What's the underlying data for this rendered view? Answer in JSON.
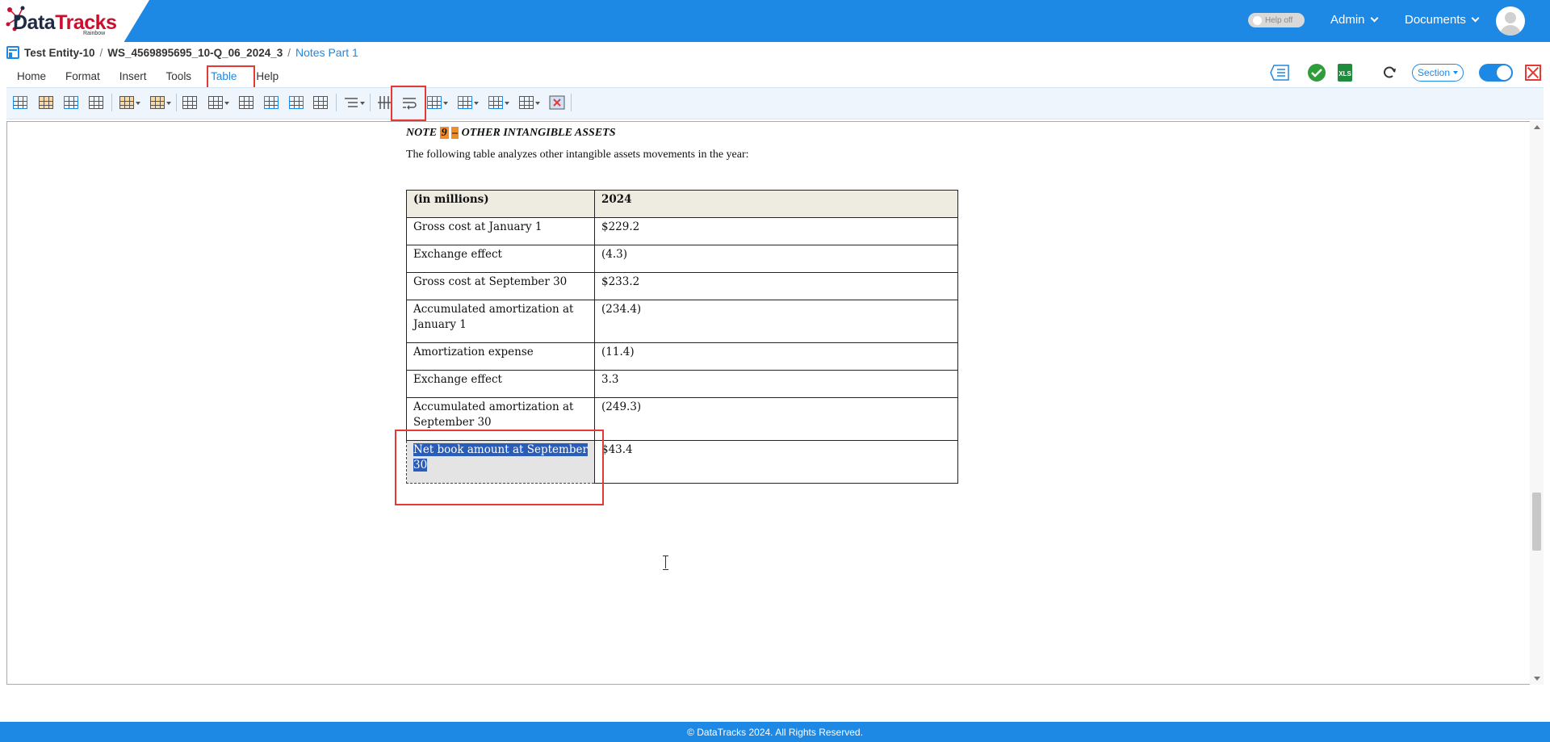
{
  "app": {
    "logo": {
      "brand_main": "Data",
      "brand_accent": "Tracks",
      "brand_sub": "Rainbow"
    },
    "help_toggle_label": "Help off",
    "user_menu_label": "Admin",
    "documents_menu_label": "Documents"
  },
  "breadcrumb": {
    "entity": "Test Entity-10",
    "workspace": "WS_4569895695_10-Q_06_2024_3",
    "section": "Notes Part 1",
    "separator": "/"
  },
  "menu": {
    "tabs": [
      {
        "label": "Home",
        "active": false
      },
      {
        "label": "Format",
        "active": false
      },
      {
        "label": "Insert",
        "active": false
      },
      {
        "label": "Tools",
        "active": false
      },
      {
        "label": "Table",
        "active": true
      },
      {
        "label": "Help",
        "active": false
      }
    ]
  },
  "right_toolbar": {
    "section_dropdown_label": "Section",
    "icons": [
      "outline-list-icon",
      "check-badge-icon",
      "xls-export-icon",
      "refresh-icon",
      "toggle-switch",
      "close-icon"
    ]
  },
  "ribbon": {
    "icons": [
      "insert-table-icon",
      "table-style-icon",
      "insert-table-above-icon",
      "table-grid-icon",
      "row-options-icon",
      "column-options-icon",
      "cell-borders-icon",
      "cell-shading-icon",
      "delete-cells-icon",
      "insert-cells-icon",
      "merge-cells-icon",
      "distribute-columns-icon",
      "numbering-icon",
      "column-divider-icon",
      "text-wrap-icon",
      "cell-alignment-icon",
      "table-properties-icon",
      "split-table-icon",
      "column-width-icon",
      "delete-table-icon"
    ],
    "highlighted_icon": "text-wrap-icon"
  },
  "document": {
    "note_title_prefix": "NOTE",
    "note_number": "9",
    "note_dash": "–",
    "note_title_rest": "OTHER INTANGIBLE ASSETS",
    "intro": "The following table analyzes other intangible assets movements in the year:",
    "table": {
      "header": [
        "(in millions)",
        "2024"
      ],
      "rows": [
        [
          "Gross cost at January 1",
          "$229.2"
        ],
        [
          "Exchange effect",
          "(4.3)"
        ],
        [
          "Gross cost at September 30",
          "$233.2"
        ],
        [
          "Accumulated amortization at January 1",
          "(234.4)"
        ],
        [
          "Amortization expense",
          "(11.4)"
        ],
        [
          "Exchange effect",
          "3.3"
        ],
        [
          "Accumulated amortization at September 30",
          "(249.3)"
        ],
        [
          "Net book amount at September 30",
          "$43.4"
        ]
      ],
      "selected_row": 7
    }
  },
  "footer": {
    "text": "© DataTracks 2024. All Rights Reserved."
  },
  "colors": {
    "primary": "#1e88e5",
    "highlight_box": "#e53935",
    "note_highlight": "#f28c28",
    "table_header_bg": "#eeebe0",
    "selection": "#2a5db8"
  }
}
